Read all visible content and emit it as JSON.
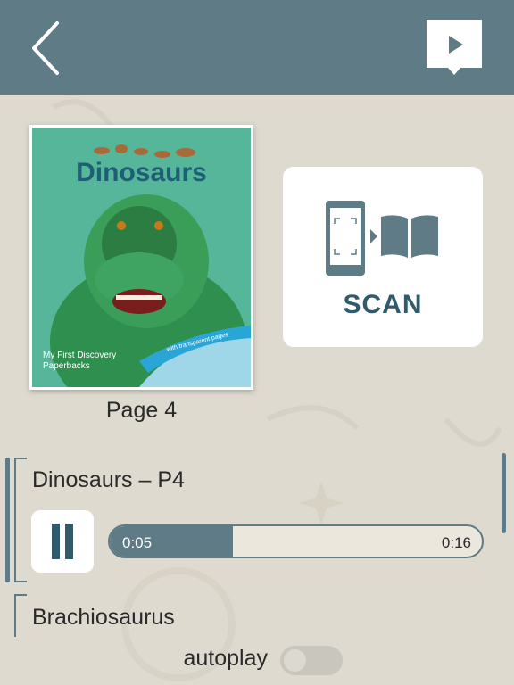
{
  "header": {
    "back_icon": "chevron-left-icon",
    "audio_book_icon": "book-play-icon"
  },
  "book": {
    "cover_title": "Dinosaurs",
    "series_line1": "My First Discovery",
    "series_line2": "Paperbacks",
    "ribbon_text": "with transparent pages",
    "page_label": "Page 4"
  },
  "scan": {
    "label": "SCAN",
    "icon": "phone-scan-book-icon"
  },
  "player": {
    "current_track": "Dinosaurs – P4",
    "current_time": "0:05",
    "total_time": "0:16",
    "progress": 0.33,
    "pause_icon": "pause-icon"
  },
  "next_track": "Brachiosaurus",
  "autoplay": {
    "label": "autoplay",
    "enabled": false
  },
  "colors": {
    "header": "#5e7b86",
    "accent": "#2f5b6c",
    "background": "#dedad0"
  }
}
